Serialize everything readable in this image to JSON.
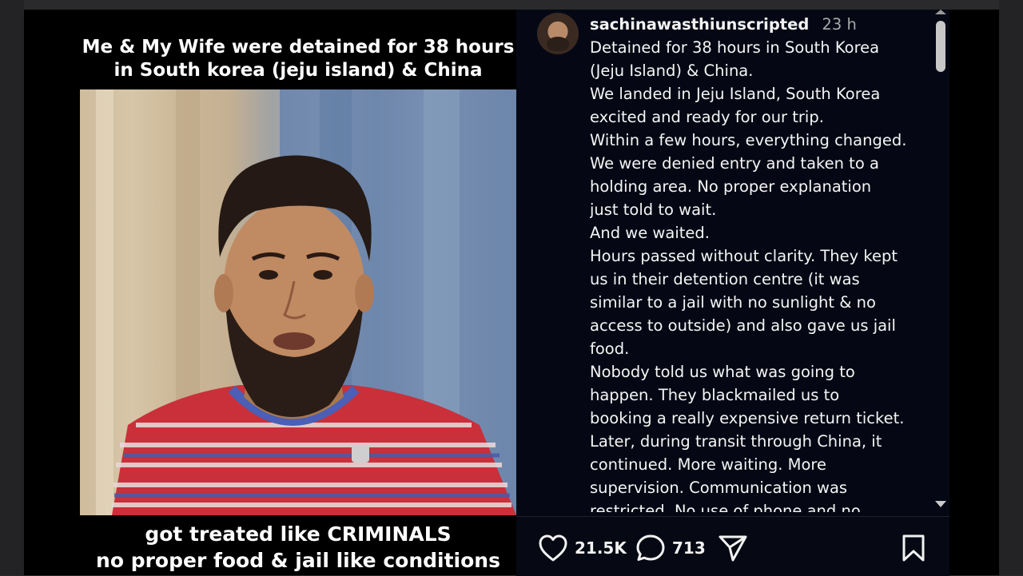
{
  "video": {
    "caption_top": [
      "Me & My Wife were detained for 38 hours",
      "in South korea (jeju island) & China"
    ],
    "caption_bottom": [
      "got treated like CRIMINALS",
      "no proper food & jail like conditions"
    ]
  },
  "post": {
    "username": "sachinawasthiunscripted",
    "time": "23 h",
    "lines": [
      "Detained for 38 hours in South Korea",
      "(Jeju Island) & China.",
      "We landed in Jeju Island, South Korea",
      "excited and ready for our trip.",
      "Within a few hours, everything changed.",
      "We were denied entry and taken to a",
      "holding area. No proper explanation",
      "just told to wait.",
      "And we waited.",
      "Hours passed without clarity. They kept",
      "us in their detention centre (it was",
      "similar to a jail with no sunlight & no",
      "access to outside) and also gave us jail",
      "food.",
      "Nobody told us what was going to",
      "happen. They blackmailed us to",
      "booking a really expensive return ticket.",
      "Later, during transit through China, it",
      "continued. More waiting. More",
      "supervision. Communication was",
      "restricted. No use of phone and no"
    ]
  },
  "actions": {
    "likes": "21.5K",
    "comments": "713"
  },
  "icons": {
    "like": "heart-icon",
    "comment": "comment-icon",
    "share": "share-icon",
    "save": "bookmark-icon"
  }
}
